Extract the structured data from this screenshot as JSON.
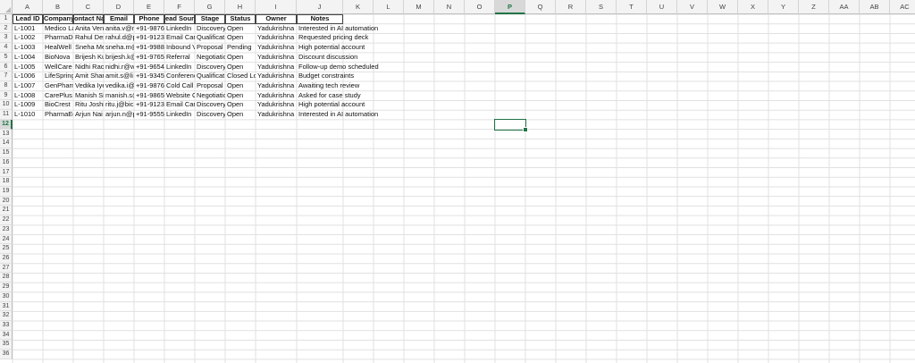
{
  "sheet": {
    "columns": [
      "A",
      "B",
      "C",
      "D",
      "E",
      "F",
      "G",
      "H",
      "I",
      "J",
      "K",
      "L",
      "M",
      "N",
      "O",
      "P",
      "Q",
      "R",
      "S",
      "T",
      "U",
      "V",
      "W",
      "X",
      "Y",
      "Z",
      "AA",
      "AB",
      "AC"
    ],
    "row_count": 36,
    "active_column": "P",
    "active_row": 12,
    "headers": [
      "Lead ID",
      "Company",
      "ontact Nam",
      "Email",
      "Phone",
      "ead Sourc",
      "Stage",
      "Status",
      "Owner",
      "Notes"
    ],
    "rows": [
      [
        "L-1001",
        "Medico La",
        "Anita Ven",
        "anita.v@n",
        "+91-98765",
        "LinkedIn",
        "Discovery",
        "Open",
        "Yadukrishna",
        "Interested in AI automation"
      ],
      [
        "L-1002",
        "PharmaDi",
        "Rahul Des",
        "rahul.d@p",
        "+91-91234",
        "Email Cam",
        "Qualificat",
        "Open",
        "Yadukrishna",
        "Requested pricing deck"
      ],
      [
        "L-1003",
        "HealWell",
        "Sneha Me",
        "sneha.m@",
        "+91-99887",
        "Inbound V",
        "Proposal",
        "Pending",
        "Yadukrishna",
        "High potential account"
      ],
      [
        "L-1004",
        "BioNova",
        "Brijesh Ku",
        "brijesh.k@",
        "+91-97654",
        "Referral",
        "Negotiatio",
        "Open",
        "Yadukrishna",
        "Discount discussion"
      ],
      [
        "L-1005",
        "WellCare",
        "Nidhi Rao",
        "nidhi.r@w",
        "+91-96543",
        "LinkedIn",
        "Discovery",
        "Open",
        "Yadukrishna",
        "Follow-up demo scheduled"
      ],
      [
        "L-1006",
        "LifeSpring",
        "Amit Shar",
        "amit.s@li",
        "+91-93456",
        "Conferenc",
        "Qualificat",
        "Closed Lo",
        "Yadukrishna",
        "Budget constraints"
      ],
      [
        "L-1007",
        "GenPharm",
        "Vedika Iye",
        "vedika.i@",
        "+91-98760",
        "Cold Call",
        "Proposal",
        "Open",
        "Yadukrishna",
        "Awaiting tech review"
      ],
      [
        "L-1008",
        "CarePlus",
        "Manish Si",
        "manish.s@",
        "+91-98650",
        "Website C",
        "Negotiatio",
        "Open",
        "Yadukrishna",
        "Asked for case study"
      ],
      [
        "L-1009",
        "BioCrest",
        "Ritu Joshi",
        "ritu.j@bic",
        "+91-91230",
        "Email Cam",
        "Discovery",
        "Open",
        "Yadukrishna",
        "High potential account"
      ],
      [
        "L-1010",
        "PharmaEd",
        "Arjun Nai",
        "arjun.n@p",
        "+91-95555",
        "LinkedIn",
        "Discovery",
        "Open",
        "Yadukrishna",
        "Interested in AI automation"
      ]
    ]
  }
}
